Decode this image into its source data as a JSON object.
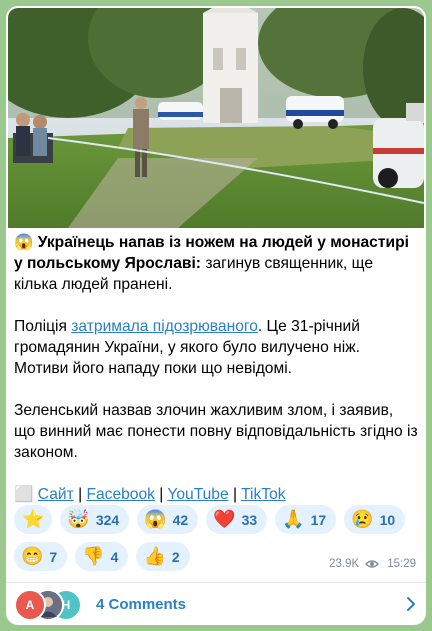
{
  "post": {
    "title_emoji": "😱",
    "headline": "Українець напав із ножем на людей у монастирі у польському Ярославі:",
    "headline_rest": " загинув священник, ще кілька людей пранені.",
    "p2_before": "Поліція ",
    "p2_link": "затримала підозрюваного",
    "p2_after": ". Це 31-річний громадянин України, у якого було вилучено ніж. Мотиви його нападу поки що невідомі.",
    "p3": "Зеленський назвав злочин жахливим злом, і заявив, що винний має понести повну відповідальність згідно із законом.",
    "links": {
      "square": "⬜",
      "site": "Сайт",
      "facebook": "Facebook",
      "youtube": "YouTube",
      "tiktok": "TikTok",
      "sep": " | "
    }
  },
  "reactions": {
    "star": {
      "emoji": "⭐"
    },
    "r1": {
      "emoji": "🤯",
      "count": "324"
    },
    "r2": {
      "emoji": "😱",
      "count": "42"
    },
    "r3": {
      "emoji": "❤️",
      "count": "33"
    },
    "r4": {
      "emoji": "🙏",
      "count": "17"
    },
    "r5": {
      "emoji": "😢",
      "count": "10"
    },
    "r6": {
      "emoji": "😁",
      "count": "7"
    },
    "r7": {
      "emoji": "👎",
      "count": "4"
    },
    "r8": {
      "emoji": "👍",
      "count": "2"
    }
  },
  "meta": {
    "views": "23.9K",
    "time": "15:29"
  },
  "comments": {
    "label": "4 Comments",
    "avatar1_letter": "A",
    "avatar3_letter": "H"
  },
  "colors": {
    "background": "#9bc88f",
    "link": "#2a80c8",
    "chip": "#e4f1ff",
    "avatar1": "#e85a4f",
    "avatar3": "#4fc3c8"
  }
}
